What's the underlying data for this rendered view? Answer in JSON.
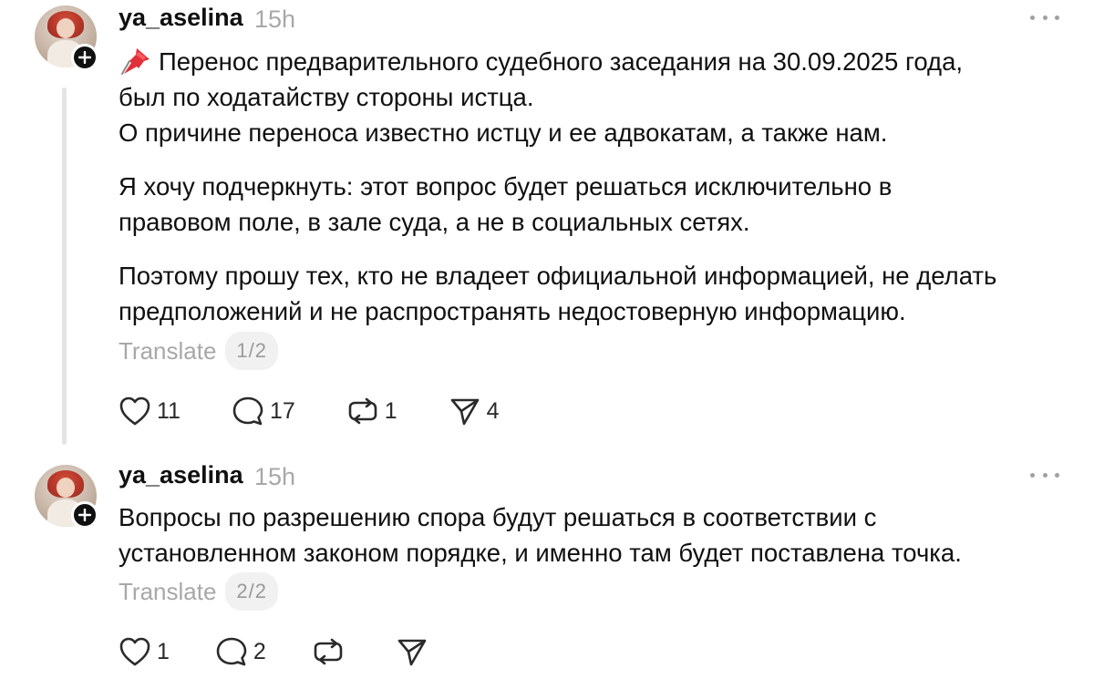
{
  "posts": [
    {
      "username": "ya_aselina",
      "time": "15h",
      "pin_icon": "pushpin-emoji",
      "paragraphs": [
        [
          "Перенос предварительного судебного заседания на 30.09.2025 года,",
          "был по ходатайству стороны истца.",
          "О причине переноса известно истцу и ее адвокатам, а также нам."
        ],
        [
          "Я хочу подчеркнуть: этот вопрос будет решаться исключительно в",
          "правовом поле, в зале суда, а не в социальных сетях."
        ],
        [
          "Поэтому прошу тех, кто не владеет официальной информацией, не делать",
          "предположений и не распространять недостоверную информацию."
        ]
      ],
      "translate_label": "Translate",
      "page_indicator": "1/2",
      "likes": "11",
      "replies": "17",
      "reposts": "1",
      "shares": "4"
    },
    {
      "username": "ya_aselina",
      "time": "15h",
      "paragraphs": [
        [
          "Вопросы по разрешению спора будут решаться в соответствии с",
          "установленном законом порядке, и именно там будет поставлена точка."
        ]
      ],
      "translate_label": "Translate",
      "page_indicator": "2/2",
      "likes": "1",
      "replies": "2",
      "reposts": "",
      "shares": ""
    }
  ],
  "colors": {
    "text": "#101010",
    "muted": "#a8a8a8",
    "thread_line": "#e4e4e4",
    "badge": "#101010"
  }
}
